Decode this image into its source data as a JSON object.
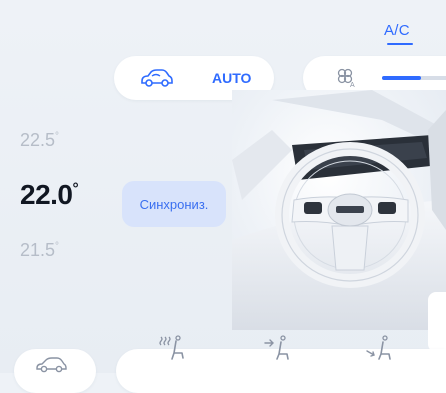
{
  "header": {
    "ac_label": "A/C"
  },
  "mode": {
    "auto_label": "AUTO"
  },
  "fan": {
    "level_fraction": 0.55
  },
  "temperature": {
    "above_int": "22.5",
    "above_unit": "°",
    "current_int": "22.0",
    "current_unit": "°",
    "below_int": "21.5",
    "below_unit": "°"
  },
  "sync": {
    "label": "Синхрониз."
  },
  "colors": {
    "accent": "#2f6bff",
    "sync_bg": "#d8e3fb",
    "muted_text": "#b6bdc8"
  },
  "icons": {
    "mode_car": "car-airflow-icon",
    "fan": "fan-auto-icon",
    "bottom_car": "car-outline-icon",
    "seat_heat": "seat-heating-icon",
    "seat_vent_up": "seat-airflow-upper-icon",
    "seat_vent_down": "seat-airflow-lower-icon"
  }
}
